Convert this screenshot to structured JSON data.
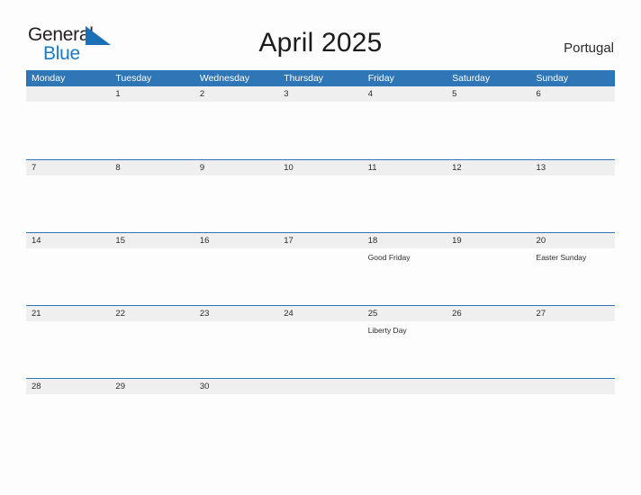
{
  "brand": {
    "name_part1": "General",
    "name_part2": "Blue",
    "flag_icon": "blue-triangle-flag-icon",
    "accent_color": "#1a7ac4"
  },
  "header": {
    "title": "April 2025",
    "country": "Portugal"
  },
  "theme": {
    "header_blue": "#2f76b6",
    "band_gray": "#efefef",
    "background": "#fdfdfd",
    "text": "#2b2b2b"
  },
  "calendar": {
    "month": "April",
    "year": "2025",
    "weekday_headers": [
      "Monday",
      "Tuesday",
      "Wednesday",
      "Thursday",
      "Friday",
      "Saturday",
      "Sunday"
    ],
    "weeks": [
      {
        "days": [
          {
            "number": "",
            "events": []
          },
          {
            "number": "1",
            "events": []
          },
          {
            "number": "2",
            "events": []
          },
          {
            "number": "3",
            "events": []
          },
          {
            "number": "4",
            "events": []
          },
          {
            "number": "5",
            "events": []
          },
          {
            "number": "6",
            "events": []
          }
        ]
      },
      {
        "days": [
          {
            "number": "7",
            "events": []
          },
          {
            "number": "8",
            "events": []
          },
          {
            "number": "9",
            "events": []
          },
          {
            "number": "10",
            "events": []
          },
          {
            "number": "11",
            "events": []
          },
          {
            "number": "12",
            "events": []
          },
          {
            "number": "13",
            "events": []
          }
        ]
      },
      {
        "days": [
          {
            "number": "14",
            "events": []
          },
          {
            "number": "15",
            "events": []
          },
          {
            "number": "16",
            "events": []
          },
          {
            "number": "17",
            "events": []
          },
          {
            "number": "18",
            "events": [
              "Good Friday"
            ]
          },
          {
            "number": "19",
            "events": []
          },
          {
            "number": "20",
            "events": [
              "Easter Sunday"
            ]
          }
        ]
      },
      {
        "days": [
          {
            "number": "21",
            "events": []
          },
          {
            "number": "22",
            "events": []
          },
          {
            "number": "23",
            "events": []
          },
          {
            "number": "24",
            "events": []
          },
          {
            "number": "25",
            "events": [
              "Liberty Day"
            ]
          },
          {
            "number": "26",
            "events": []
          },
          {
            "number": "27",
            "events": []
          }
        ]
      },
      {
        "days": [
          {
            "number": "28",
            "events": []
          },
          {
            "number": "29",
            "events": []
          },
          {
            "number": "30",
            "events": []
          },
          {
            "number": "",
            "events": []
          },
          {
            "number": "",
            "events": []
          },
          {
            "number": "",
            "events": []
          },
          {
            "number": "",
            "events": []
          }
        ]
      }
    ]
  }
}
